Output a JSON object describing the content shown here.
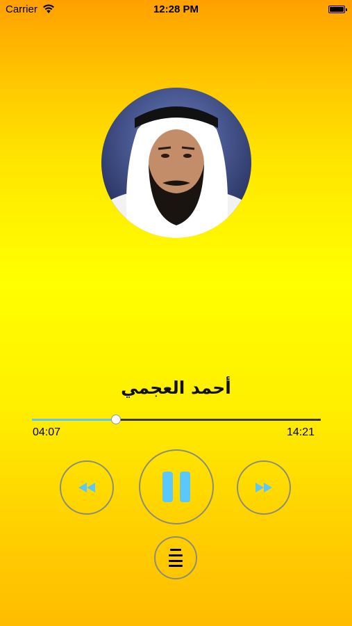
{
  "status_bar": {
    "carrier": "Carrier",
    "time": "12:28 PM",
    "battery_level": 1.0
  },
  "player": {
    "reciter_name": "أحمد العجمي",
    "avatar_description": "reciter-photo",
    "elapsed": "04:07",
    "total": "14:21",
    "progress": 0.29,
    "accent_color": "#5ac8fa"
  },
  "controls": {
    "rewind_icon": "rewind-icon",
    "play_pause_icon": "pause-icon",
    "forward_icon": "fast-forward-icon",
    "playlist_icon": "list-icon"
  }
}
